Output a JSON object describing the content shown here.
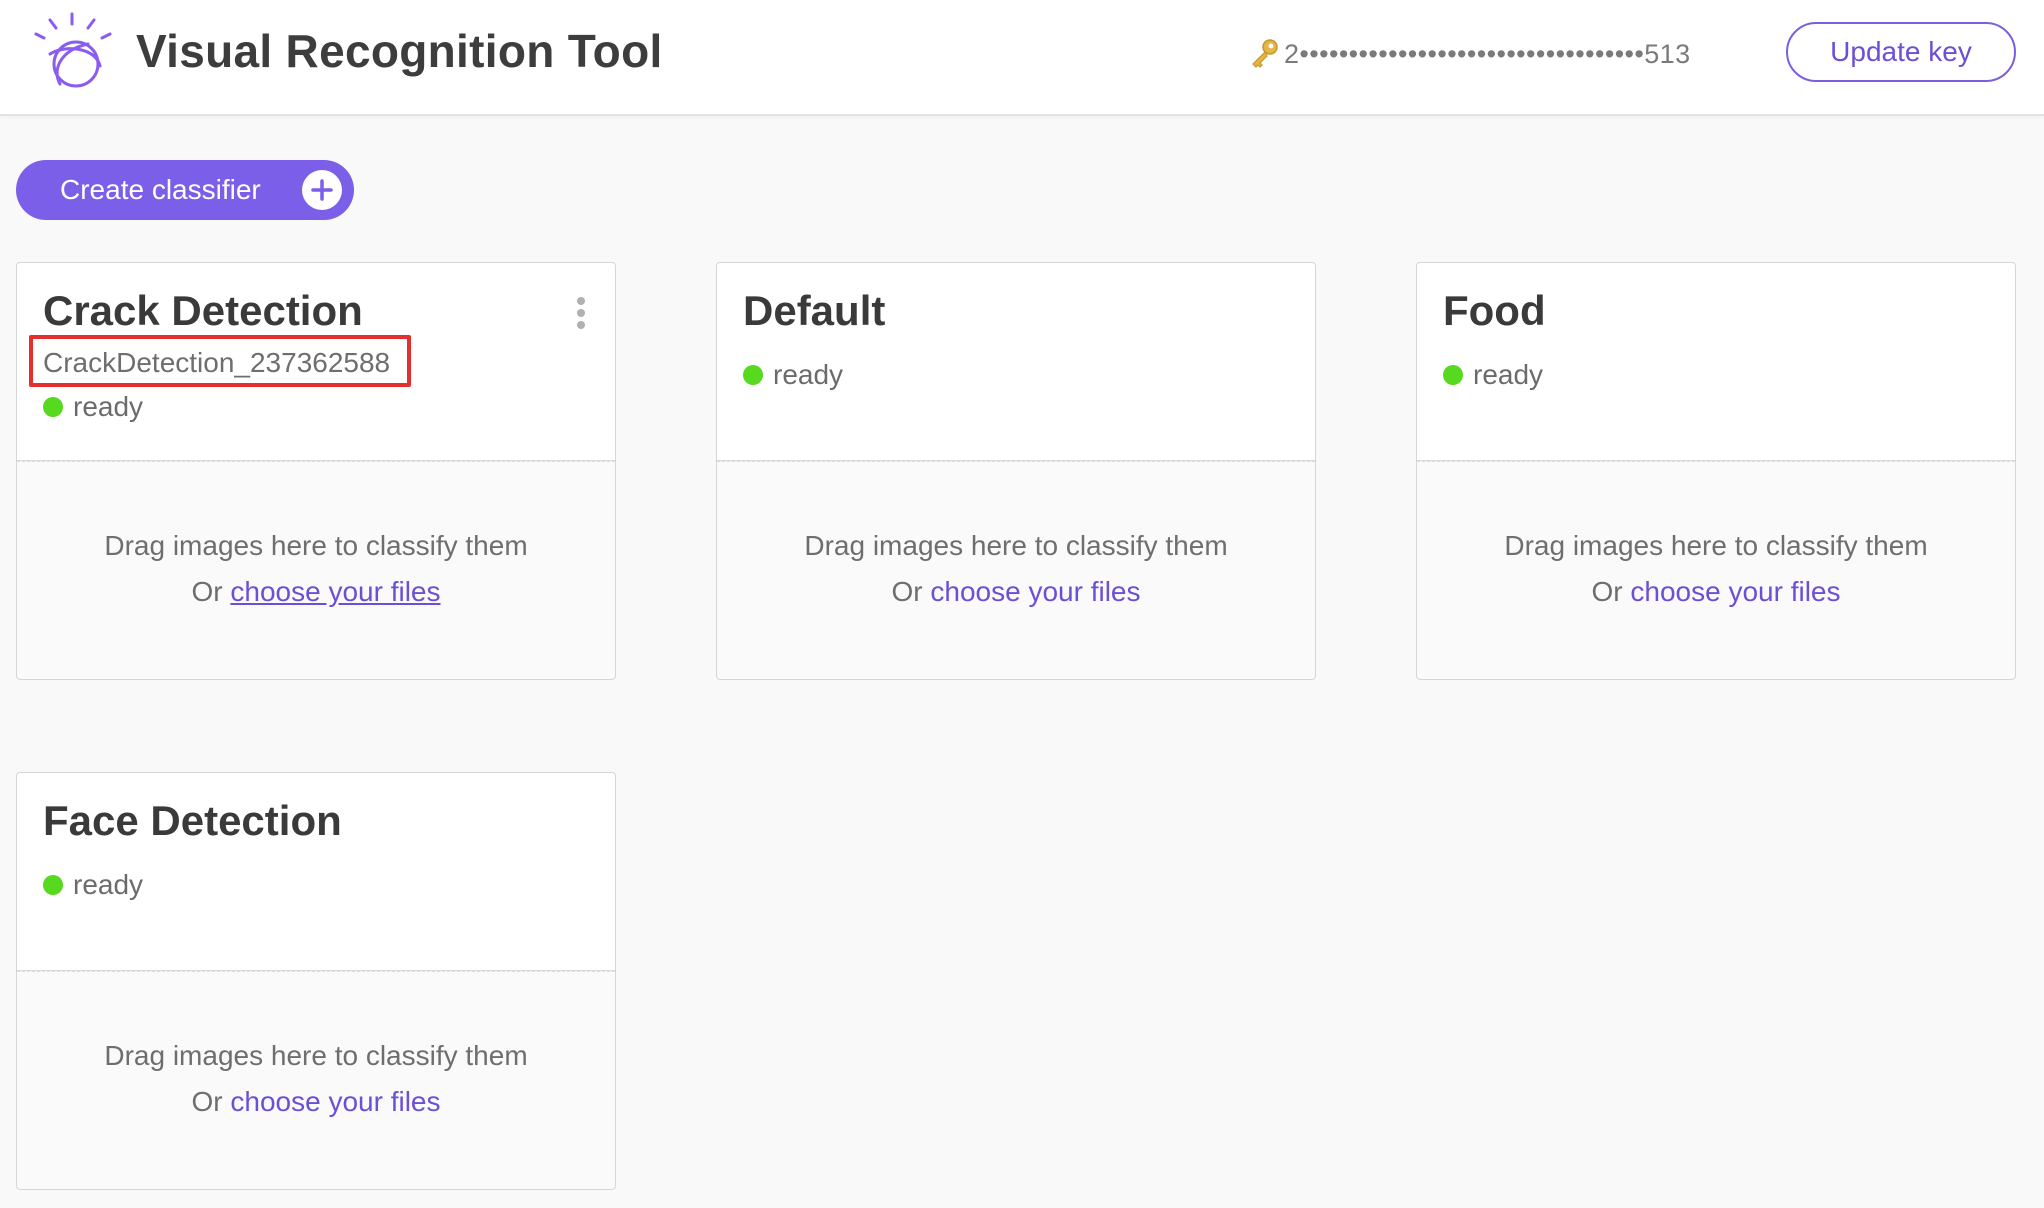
{
  "header": {
    "title": "Visual Recognition Tool",
    "logo_icon": "ibm-watson-icon",
    "api_key_masked": "2•••••••••••••••••••••••••••••••••••513",
    "update_key_label": "Update key"
  },
  "toolbar": {
    "create_label": "Create classifier",
    "create_icon": "plus-icon"
  },
  "colors": {
    "accent": "#7b5fe8",
    "link": "#6b4fd6",
    "status_ready": "#56d91f",
    "highlight": "#e52f2f"
  },
  "classifiers": [
    {
      "name": "Crack Detection",
      "id": "CrackDetection_237362588",
      "status": "ready",
      "drop_text": "Drag images here to classify them",
      "drop_or": "Or",
      "choose_label": "choose your files"
    },
    {
      "name": "Default",
      "status": "ready",
      "drop_text": "Drag images here to classify them",
      "drop_or": "Or",
      "choose_label": "choose your files"
    },
    {
      "name": "Food",
      "status": "ready",
      "drop_text": "Drag images here to classify them",
      "drop_or": "Or",
      "choose_label": "choose your files"
    },
    {
      "name": "Face Detection",
      "status": "ready",
      "drop_text": "Drag images here to classify them",
      "drop_or": "Or",
      "choose_label": "choose your files"
    }
  ]
}
